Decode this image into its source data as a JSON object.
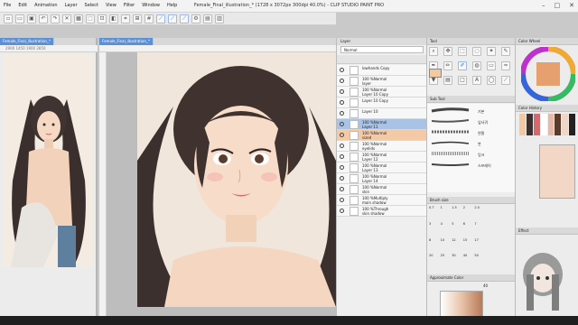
{
  "app": {
    "title": "Female_Final_illustration_* (1728 x 3072px 300dpi 40.0%) - CLIP STUDIO PAINT PRO"
  },
  "menu": [
    "File",
    "Edit",
    "Animation",
    "Layer",
    "Select",
    "View",
    "Filter",
    "Window",
    "Help"
  ],
  "tabs": {
    "left": "Female_Final_illustration_*",
    "center": "Female_Final_illustration_*"
  },
  "ruler": {
    "left": "2900 1450 1900 2850"
  },
  "panels": {
    "layer": "Layer",
    "tool": "Tool",
    "subtool": "Sub Tool",
    "brush_size": "Brush size",
    "color_wheel": "Color Wheel",
    "color_history": "Color History",
    "effect": "Effect",
    "approx_color": "Approximate Color"
  },
  "layer_blend": "Normal",
  "layers": [
    {
      "name": "lowhands Copy",
      "sub": "",
      "sel": false
    },
    {
      "name": "100 %Normal",
      "sub": "layer",
      "sel": false
    },
    {
      "name": "100 %Normal",
      "sub": "Layer 10 Copy",
      "sel": false
    },
    {
      "name": "Layer 10 Copy",
      "sub": "",
      "sel": false
    },
    {
      "name": "Layer 10",
      "sub": "",
      "sel": false
    },
    {
      "name": "100 %Normal",
      "sub": "Layer 11",
      "sel": true
    },
    {
      "name": "100 %Normal",
      "sub": "sized",
      "sel": false
    },
    {
      "name": "100 %Normal",
      "sub": "eyelids",
      "sel": false
    },
    {
      "name": "100 %Normal",
      "sub": "Layer 12",
      "sel": false
    },
    {
      "name": "100 %Normal",
      "sub": "Layer 13",
      "sel": false
    },
    {
      "name": "100 %Normal",
      "sub": "Layer 14",
      "sel": false
    },
    {
      "name": "100 %Normal",
      "sub": "skin",
      "sel": false
    },
    {
      "name": "100 %Multiply",
      "sub": "main shadow",
      "sel": false
    },
    {
      "name": "100 %Through",
      "sub": "skin shadow",
      "sel": false
    }
  ],
  "subtool_items": [
    "기본",
    "잎사귀",
    "연필",
    "붓",
    "잉크",
    "스프레이"
  ],
  "brush_sizes": [
    "0.7",
    "1",
    "1.5",
    "2",
    "2.5",
    "3",
    "4",
    "5",
    "6",
    "7",
    "8",
    "10",
    "12",
    "15",
    "17",
    "20",
    "25",
    "30",
    "40",
    "50"
  ],
  "approx_value": "40",
  "colors": {
    "accent": "#5b8fd6",
    "current": "#f4c8a0",
    "selected_layer": "#a9c3e6"
  }
}
